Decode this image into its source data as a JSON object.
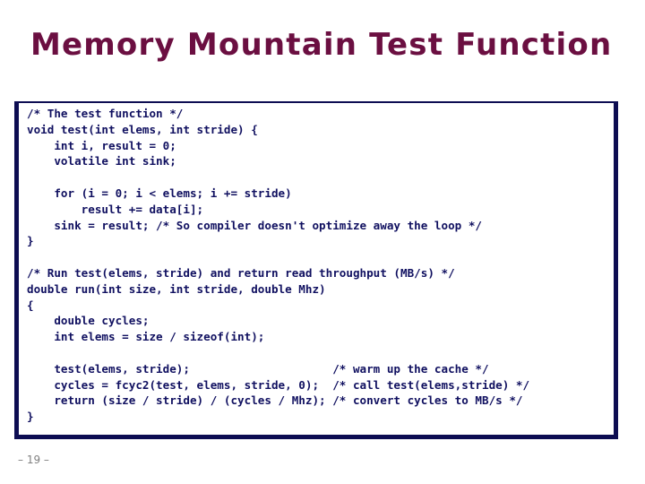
{
  "slide": {
    "title": "Memory Mountain Test Function",
    "page_number": "– 19 –",
    "title_color": "#6B0F41",
    "code_color": "#101060",
    "border_color": "#0D0D52",
    "background_color": "#FFFFFF",
    "page_number_color": "#808080"
  },
  "code": {
    "language": "c",
    "lines": [
      "/* The test function */",
      "void test(int elems, int stride) {",
      "    int i, result = 0;",
      "    volatile int sink;",
      "",
      "    for (i = 0; i < elems; i += stride)",
      "        result += data[i];",
      "    sink = result; /* So compiler doesn't optimize away the loop */",
      "}",
      "",
      "/* Run test(elems, stride) and return read throughput (MB/s) */",
      "double run(int size, int stride, double Mhz)",
      "{",
      "    double cycles;",
      "    int elems = size / sizeof(int);",
      "",
      "    test(elems, stride);                     /* warm up the cache */",
      "    cycles = fcyc2(test, elems, stride, 0);  /* call test(elems,stride) */",
      "    return (size / stride) / (cycles / Mhz); /* convert cycles to MB/s */",
      "}"
    ],
    "text": "/* The test function */\nvoid test(int elems, int stride) {\n    int i, result = 0;\n    volatile int sink;\n\n    for (i = 0; i < elems; i += stride)\n        result += data[i];\n    sink = result; /* So compiler doesn't optimize away the loop */\n}\n\n/* Run test(elems, stride) and return read throughput (MB/s) */\ndouble run(int size, int stride, double Mhz)\n{\n    double cycles;\n    int elems = size / sizeof(int);\n\n    test(elems, stride);                     /* warm up the cache */\n    cycles = fcyc2(test, elems, stride, 0);  /* call test(elems,stride) */\n    return (size / stride) / (cycles / Mhz); /* convert cycles to MB/s */\n}"
  }
}
